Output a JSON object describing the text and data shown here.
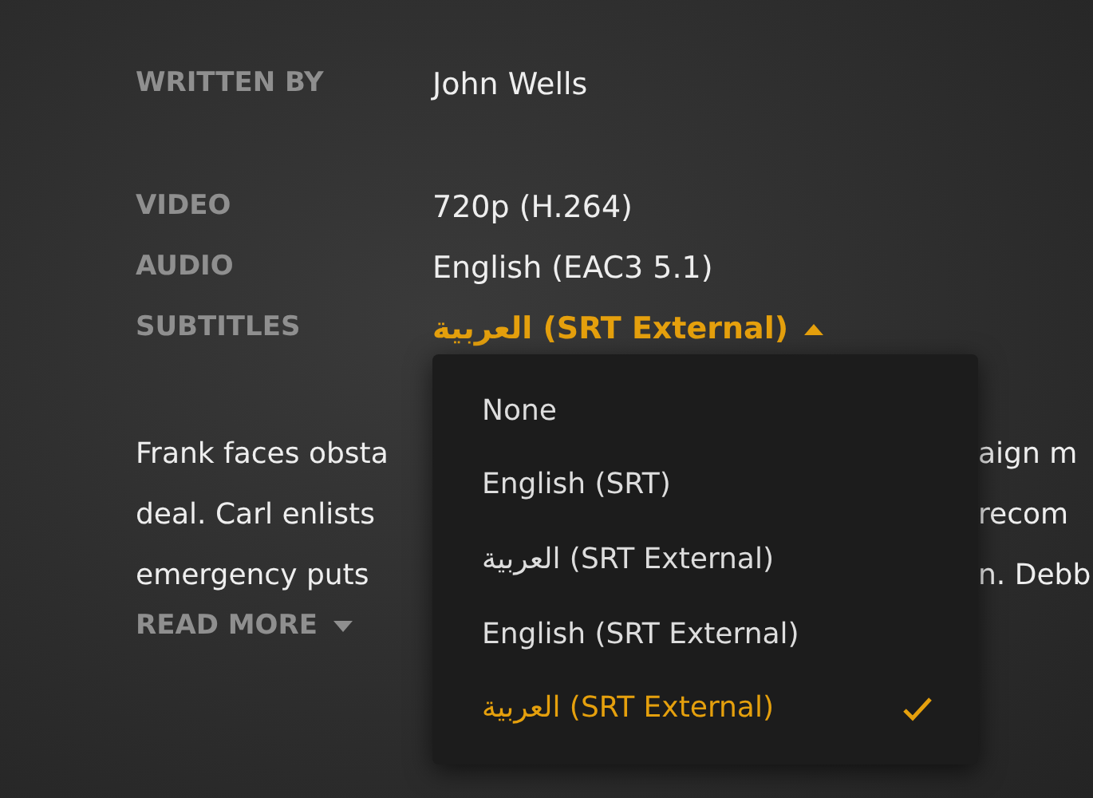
{
  "details": [
    {
      "kind": "text",
      "label": "WRITTEN BY",
      "value": "John Wells"
    },
    {
      "kind": "text",
      "label": "VIDEO",
      "value": "720p (H.264)"
    },
    {
      "kind": "text",
      "label": "AUDIO",
      "value": "English (EAC3 5.1)"
    },
    {
      "kind": "dropdown",
      "label": "SUBTITLES",
      "value": "العربية (SRT External)",
      "expanded": true
    }
  ],
  "summary_lines": [
    {
      "left": "Frank faces obsta",
      "right": "aign m"
    },
    {
      "left": "deal. Carl enlists",
      "right": "recom"
    },
    {
      "left": "emergency puts",
      "right": "n. Debb"
    }
  ],
  "read_more": {
    "label": "READ MORE",
    "expanded": false
  },
  "subtitle_menu": [
    {
      "label": "None",
      "selected": false
    },
    {
      "label": "English (SRT)",
      "selected": false
    },
    {
      "label": "العربية (SRT External)",
      "selected": false
    },
    {
      "label": "English (SRT External)",
      "selected": false
    },
    {
      "label": "العربية (SRT External)",
      "selected": true
    }
  ]
}
